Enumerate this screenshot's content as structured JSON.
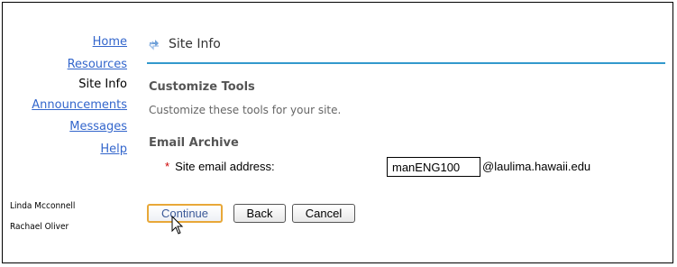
{
  "sidebar": {
    "items": [
      {
        "label": "Home",
        "link": true
      },
      {
        "label": "Resources",
        "link": true
      },
      {
        "label": "Site Info",
        "link": false
      },
      {
        "label": "Announcements",
        "link": true
      },
      {
        "label": "Messages",
        "link": true
      },
      {
        "label": "Help",
        "link": true
      }
    ],
    "users": [
      "Linda Mcconnell",
      "Rachael Oliver"
    ]
  },
  "header": {
    "title": "Site Info",
    "icon": "refresh-arrows-icon"
  },
  "main": {
    "section_title": "Customize Tools",
    "description": "Customize these tools for your site.",
    "email_section_title": "Email Archive",
    "field": {
      "required_mark": "*",
      "label": "Site email address:",
      "value": "manENG100",
      "domain": "@laulima.hawaii.edu"
    }
  },
  "buttons": {
    "continue": "Continue",
    "back": "Back",
    "cancel": "Cancel"
  },
  "colors": {
    "link": "#3366cc",
    "accent_rule": "#3399cc",
    "focus_ring": "#e8a838",
    "required": "#cc0000"
  }
}
